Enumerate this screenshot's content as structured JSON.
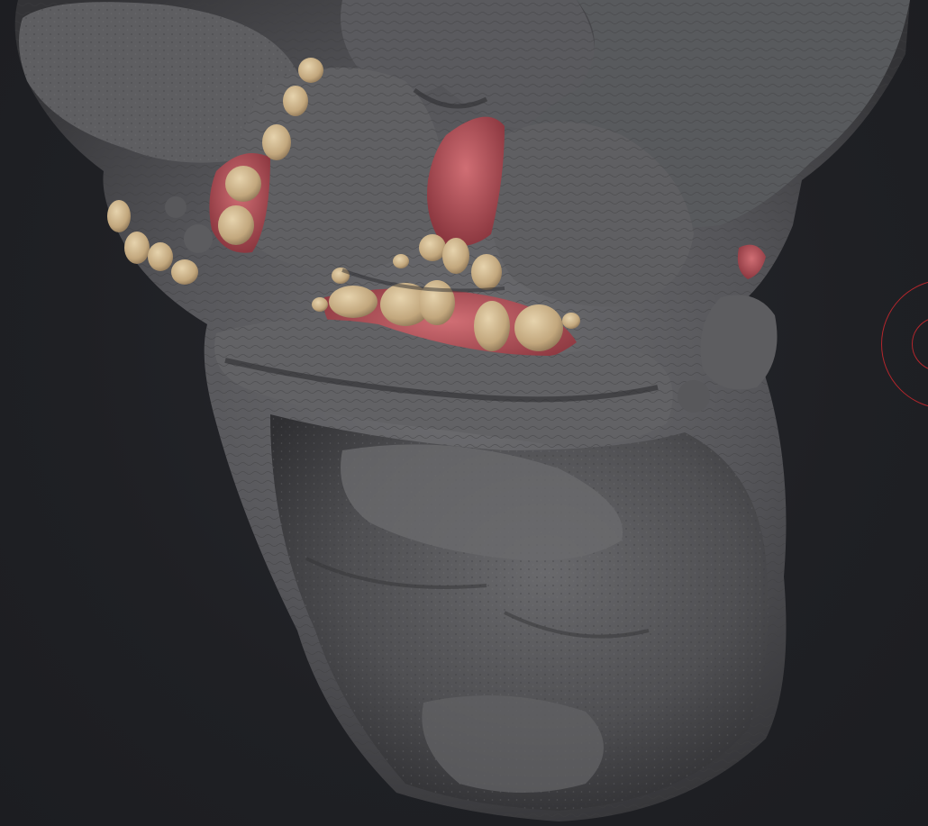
{
  "viewport": {
    "background_color": "#1f2024",
    "content": "sculpted-head-model"
  },
  "model": {
    "skin_color": "#5c5c5e",
    "skin_shadow_color": "#2e2e31",
    "skin_highlight_color": "#7c7c7f",
    "teeth_color": "#cbb48c",
    "gum_color": "#b4525a"
  },
  "brush_cursor": {
    "color": "#b3262c"
  }
}
